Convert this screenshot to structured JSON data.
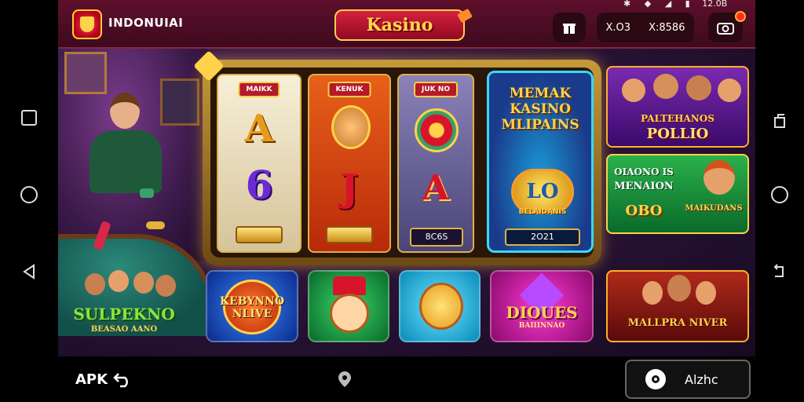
{
  "header": {
    "brand": "INDONUIAI",
    "title": "Kasino",
    "balance_left": "X.O3",
    "balance_right": "X:8586",
    "status_time": "12.0B"
  },
  "reels": {
    "reel1_header": "MAIKK",
    "reel1_top": "A",
    "reel1_mid": "6",
    "reel2_header": "KENUK",
    "reel2_mid": "J",
    "reel3_header": "JUK NO",
    "reel3_mid": "A",
    "reel3_value": "8C6S"
  },
  "feature": {
    "title": "MEMAK KASINO MLIPAINS",
    "coin": "LO",
    "coin_caption": "BELAIDANIS",
    "year": "2O21"
  },
  "promos": {
    "card1": "POLLIO",
    "card1_top": "PALTEHANOS",
    "card2_top": "OIAONO IS",
    "card2_mid": "MENAION",
    "card2_num": "OBO",
    "card2_side": "MAIKUDANS",
    "card3": "MALLPRA NIVER"
  },
  "tiles": {
    "tile1": "SULPEKNO",
    "tile1_sub": "BEASAO AANO",
    "tile2": "KEBYNNO NLIVE",
    "tile5": "DIOUES",
    "tile5_sub": "BAIIINNAO"
  },
  "bottom": {
    "apk_label": "APK",
    "action_label": "Alzhc"
  },
  "colors": {
    "topbar": "#5e0f2c",
    "accent_gold": "#ffd24a",
    "accent_red": "#d6213f"
  }
}
